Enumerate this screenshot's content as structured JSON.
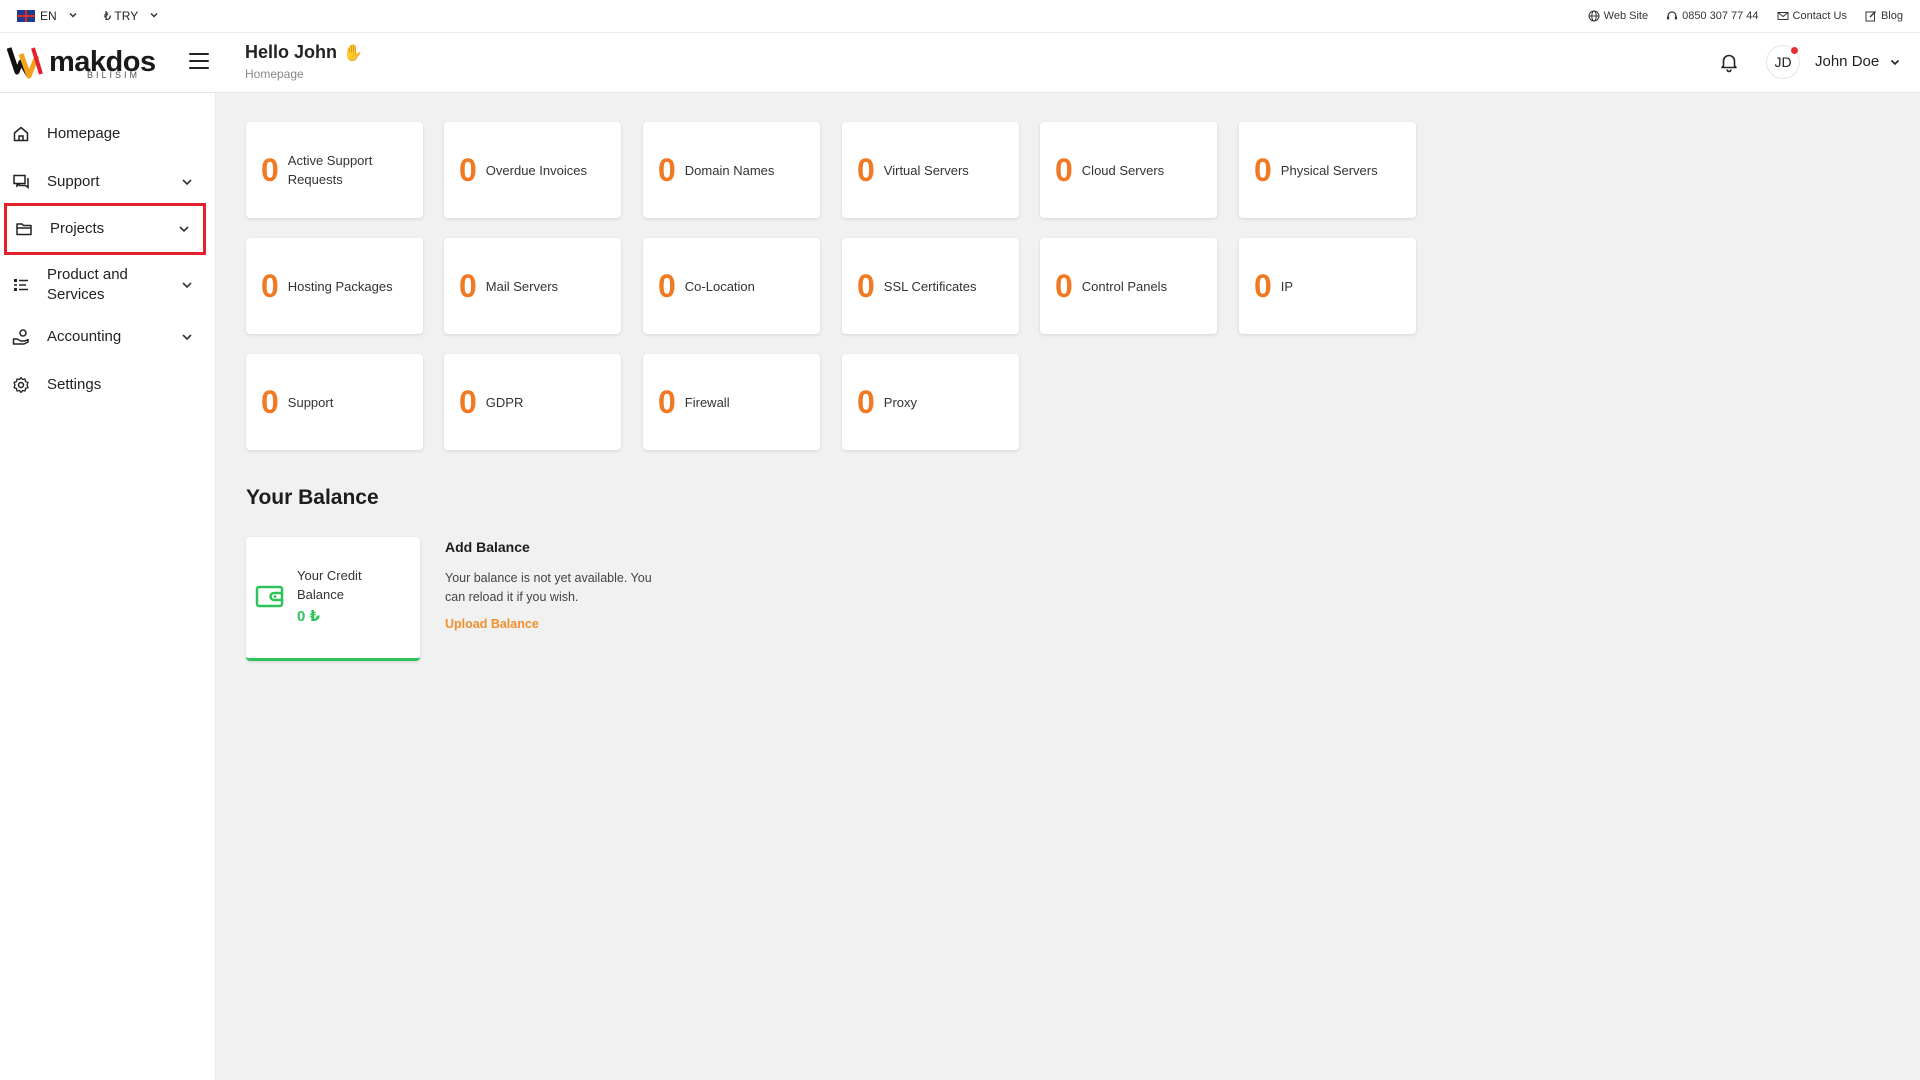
{
  "topbar": {
    "language": "EN",
    "currency": "₺ TRY",
    "links": [
      {
        "label": "Web Site"
      },
      {
        "label": "0850 307 77 44"
      },
      {
        "label": "Contact Us"
      },
      {
        "label": "Blog"
      }
    ]
  },
  "header": {
    "logo_text": "makdos",
    "logo_sub": "BILISIM",
    "greeting": "Hello John",
    "breadcrumb": "Homepage",
    "avatar_initials": "JD",
    "username": "John Doe"
  },
  "sidebar": {
    "items": [
      {
        "label": "Homepage"
      },
      {
        "label": "Support"
      },
      {
        "label": "Projects"
      },
      {
        "label": "Product and Services"
      },
      {
        "label": "Accounting"
      },
      {
        "label": "Settings"
      }
    ]
  },
  "stats": [
    {
      "value": "0",
      "label": "Active Support Requests"
    },
    {
      "value": "0",
      "label": "Overdue Invoices"
    },
    {
      "value": "0",
      "label": "Domain Names"
    },
    {
      "value": "0",
      "label": "Virtual Servers"
    },
    {
      "value": "0",
      "label": "Cloud Servers"
    },
    {
      "value": "0",
      "label": "Physical Servers"
    },
    {
      "value": "0",
      "label": "Hosting Packages"
    },
    {
      "value": "0",
      "label": "Mail Servers"
    },
    {
      "value": "0",
      "label": "Co-Location"
    },
    {
      "value": "0",
      "label": "SSL Certificates"
    },
    {
      "value": "0",
      "label": "Control Panels"
    },
    {
      "value": "0",
      "label": "IP"
    },
    {
      "value": "0",
      "label": "Support"
    },
    {
      "value": "0",
      "label": "GDPR"
    },
    {
      "value": "0",
      "label": "Firewall"
    },
    {
      "value": "0",
      "label": "Proxy"
    }
  ],
  "balance": {
    "title": "Your Balance",
    "credit_label": "Your Credit Balance",
    "credit_value": "0 ₺",
    "add_title": "Add Balance",
    "add_text": "Your balance is not yet available. You can reload it if you wish.",
    "add_link": "Upload Balance"
  },
  "colors": {
    "accent_orange": "#f07a23",
    "success_green": "#2cc35a",
    "highlight_red": "#e3202b",
    "link_orange": "#f0902a"
  },
  "icons": {
    "sidebar": [
      "home-icon",
      "support-chat-icon",
      "folder-icon",
      "list-icon",
      "accounting-icon",
      "gear-icon"
    ]
  }
}
